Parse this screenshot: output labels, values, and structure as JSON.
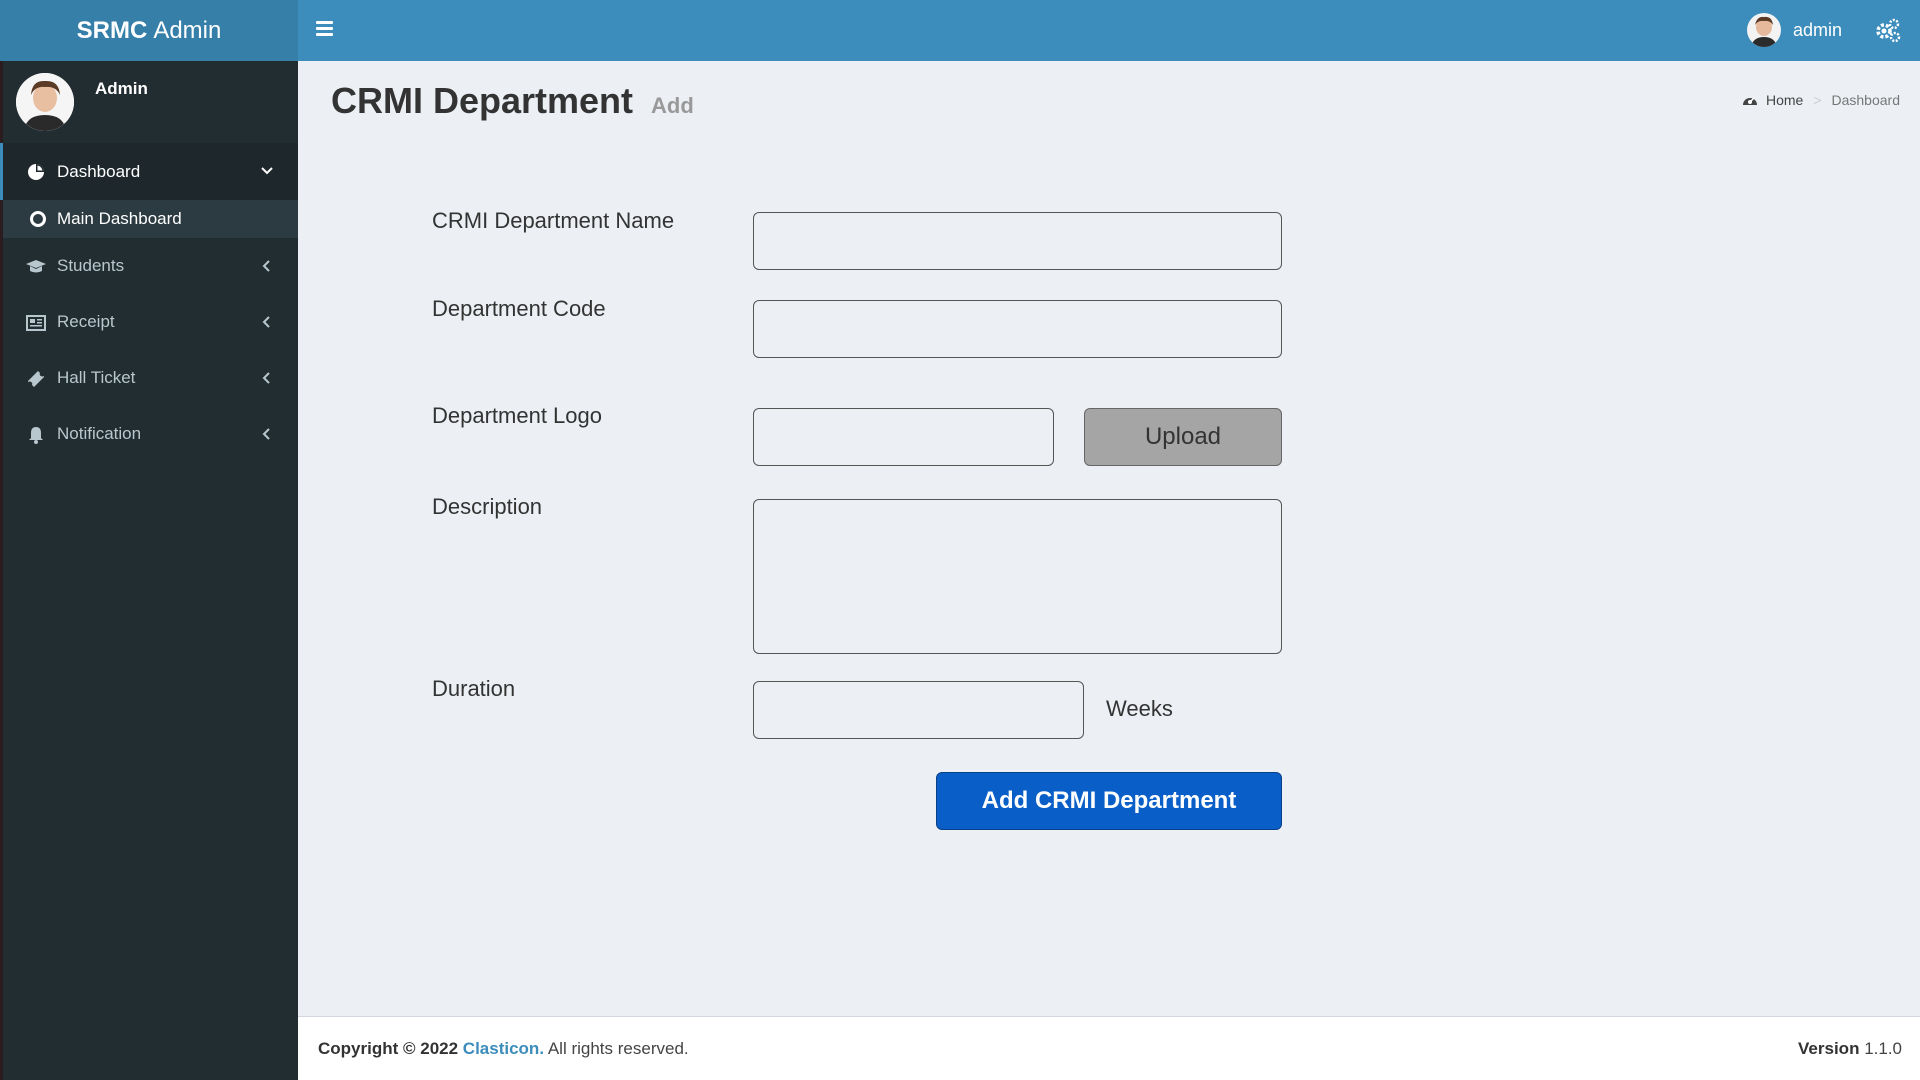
{
  "header": {
    "logo_bold": "SRMC",
    "logo_rest": "Admin",
    "user_name": "admin"
  },
  "sidebar": {
    "user_name": "Admin",
    "items": [
      {
        "label": "Dashboard",
        "icon": "dashboard-icon",
        "state": "expanded"
      },
      {
        "label": "Main Dashboard",
        "icon": "circle-icon",
        "state": "active-sub"
      },
      {
        "label": "Students",
        "icon": "graduation-cap-icon",
        "state": "collapsed"
      },
      {
        "label": "Receipt",
        "icon": "newspaper-icon",
        "state": "collapsed"
      },
      {
        "label": "Hall Ticket",
        "icon": "ticket-icon",
        "state": "collapsed"
      },
      {
        "label": "Notification",
        "icon": "bell-icon",
        "state": "collapsed"
      }
    ]
  },
  "page": {
    "title": "CRMI Department",
    "subtitle": "Add",
    "breadcrumb": {
      "home": "Home",
      "current": "Dashboard"
    }
  },
  "form": {
    "name_label": "CRMI Department Name",
    "code_label": "Department Code",
    "logo_label": "Department Logo",
    "upload_label": "Upload",
    "description_label": "Description",
    "duration_label": "Duration",
    "duration_unit": "Weeks",
    "submit_label": "Add CRMI Department",
    "values": {
      "name": "",
      "code": "",
      "logo": "",
      "description": "",
      "duration": ""
    }
  },
  "footer": {
    "copyright": "Copyright © 2022",
    "brand": "Clasticon.",
    "rights": "All rights reserved.",
    "version_label": "Version",
    "version_number": "1.1.0"
  },
  "colors": {
    "header": "#3c8dbc",
    "logo_bg": "#367fa9",
    "sidebar": "#222d32",
    "submit_button": "#0a5ec7",
    "upload_button": "#a5a5a5",
    "content_bg": "#ecf0f5"
  }
}
